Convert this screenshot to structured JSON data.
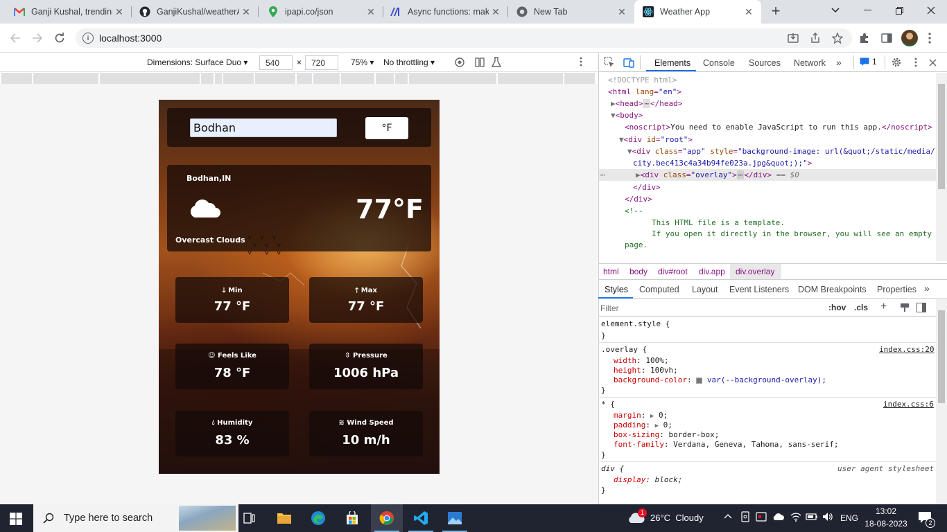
{
  "browser": {
    "tabs": [
      {
        "title": "Ganji Kushal, trending",
        "icon": "gmail-icon"
      },
      {
        "title": "GanjiKushal/weatherA",
        "icon": "github-icon"
      },
      {
        "title": "ipapi.co/json",
        "icon": "map-pin-icon"
      },
      {
        "title": "Async functions: makin",
        "icon": "mdn-icon"
      },
      {
        "title": "New Tab",
        "icon": "chrome-icon"
      },
      {
        "title": "Weather App",
        "icon": "react-icon"
      }
    ],
    "url": "localhost:3000"
  },
  "device_toolbar": {
    "dimensions_label": "Dimensions: Surface Duo",
    "width": "540",
    "height": "720",
    "zoom": "75%",
    "throttling": "No throttling"
  },
  "app": {
    "search_value": "Bodhan",
    "unit_button": "°F",
    "location": "Bodhan,IN",
    "temperature": "77°F",
    "description": "Overcast Clouds",
    "cards": [
      {
        "label": "Min",
        "value": "77 °F",
        "icon": "arrow-down-icon"
      },
      {
        "label": "Max",
        "value": "77 °F",
        "icon": "arrow-up-icon"
      },
      {
        "label": "Feels Like",
        "value": "78 °F",
        "icon": "smile-icon"
      },
      {
        "label": "Pressure",
        "value": "1006 hPa",
        "icon": "compress-icon"
      },
      {
        "label": "Humidity",
        "value": "83 %",
        "icon": "droplet-icon"
      },
      {
        "label": "Wind Speed",
        "value": "10 m/h",
        "icon": "wind-icon"
      }
    ]
  },
  "devtools": {
    "tabs": [
      "Elements",
      "Console",
      "Sources",
      "Network"
    ],
    "issues_count": "1",
    "dom": {
      "doctype": "<!DOCTYPE html>",
      "noscript_text": "You need to enable JavaScript to run this app.",
      "app_style_1": "background-image: url(&quot;/static/media/",
      "app_style_2": "city.bec413c4a34b94fe023a.jpg&quot;);",
      "selected_marker": "== $0",
      "comment_1": "This HTML file is a template.",
      "comment_2": "If you open it directly in the browser, you will see an empty",
      "comment_3": "page."
    },
    "breadcrumbs": [
      "html",
      "body",
      "div#root",
      "div.app",
      "div.overlay"
    ],
    "style_tabs": [
      "Styles",
      "Computed",
      "Layout",
      "Event Listeners",
      "DOM Breakpoints",
      "Properties"
    ],
    "filter_placeholder": "Filter",
    "hov": ":hov",
    "cls": ".cls",
    "rules": {
      "element_style": "element.style {",
      "overlay_selector": ".overlay {",
      "overlay_source": "index.css:20",
      "overlay_props": [
        {
          "prop": "width",
          "val": "100%;"
        },
        {
          "prop": "height",
          "val": "100vh;"
        },
        {
          "prop": "background-color",
          "val": "var(--background-overlay);"
        }
      ],
      "star_selector": "* {",
      "star_source": "index.css:6",
      "star_props": [
        {
          "prop": "margin",
          "val": "0;"
        },
        {
          "prop": "padding",
          "val": "0;"
        },
        {
          "prop": "box-sizing",
          "val": "border-box;"
        },
        {
          "prop": "font-family",
          "val": "Verdana, Geneva, Tahoma, sans-serif;"
        }
      ],
      "div_selector": "div {",
      "div_source": "user agent stylesheet",
      "div_prop": "display",
      "div_val": "block;"
    }
  },
  "taskbar": {
    "search_placeholder": "Type here to search",
    "weather": "26°C  Cloudy",
    "weather_badge": "1",
    "language": "ENG",
    "time": "13:02",
    "date": "18-08-2023",
    "notifications": "2"
  },
  "colors": {
    "accent": "#1a73e8",
    "taskbar": "#202431",
    "devtools_tag": "#881280"
  }
}
